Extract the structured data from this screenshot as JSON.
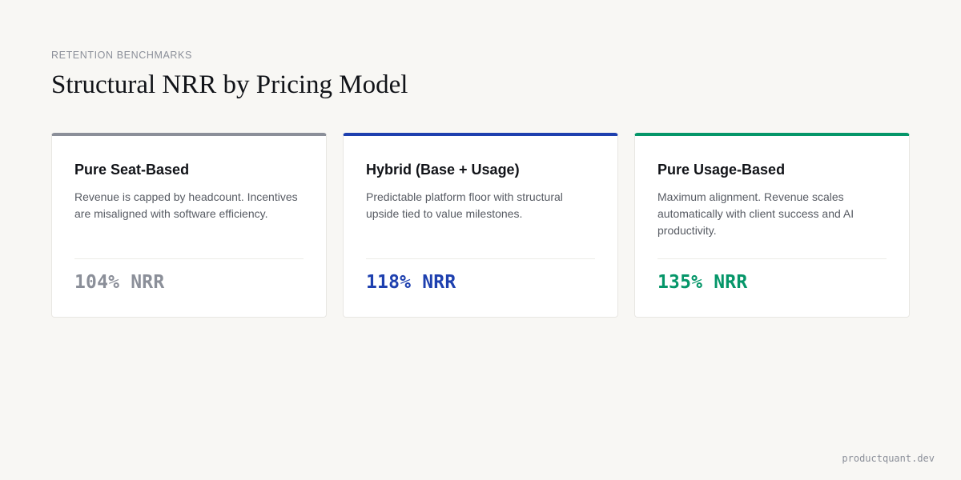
{
  "header": {
    "eyebrow": "RETENTION BENCHMARKS",
    "title": "Structural NRR by Pricing Model"
  },
  "cards": [
    {
      "title": "Pure Seat-Based",
      "description": "Revenue is capped by headcount. Incentives are misaligned with software efficiency.",
      "metric": "104% NRR",
      "nrr_percent": 104,
      "accent_color": "#8b8f99"
    },
    {
      "title": "Hybrid (Base + Usage)",
      "description": "Predictable platform floor with structural upside tied to value milestones.",
      "metric": "118% NRR",
      "nrr_percent": 118,
      "accent_color": "#1e40af"
    },
    {
      "title": "Pure Usage-Based",
      "description": "Maximum alignment. Revenue scales automatically with client success and AI productivity.",
      "metric": "135% NRR",
      "nrr_percent": 135,
      "accent_color": "#059669"
    }
  ],
  "footer": {
    "url": "productquant.dev"
  }
}
